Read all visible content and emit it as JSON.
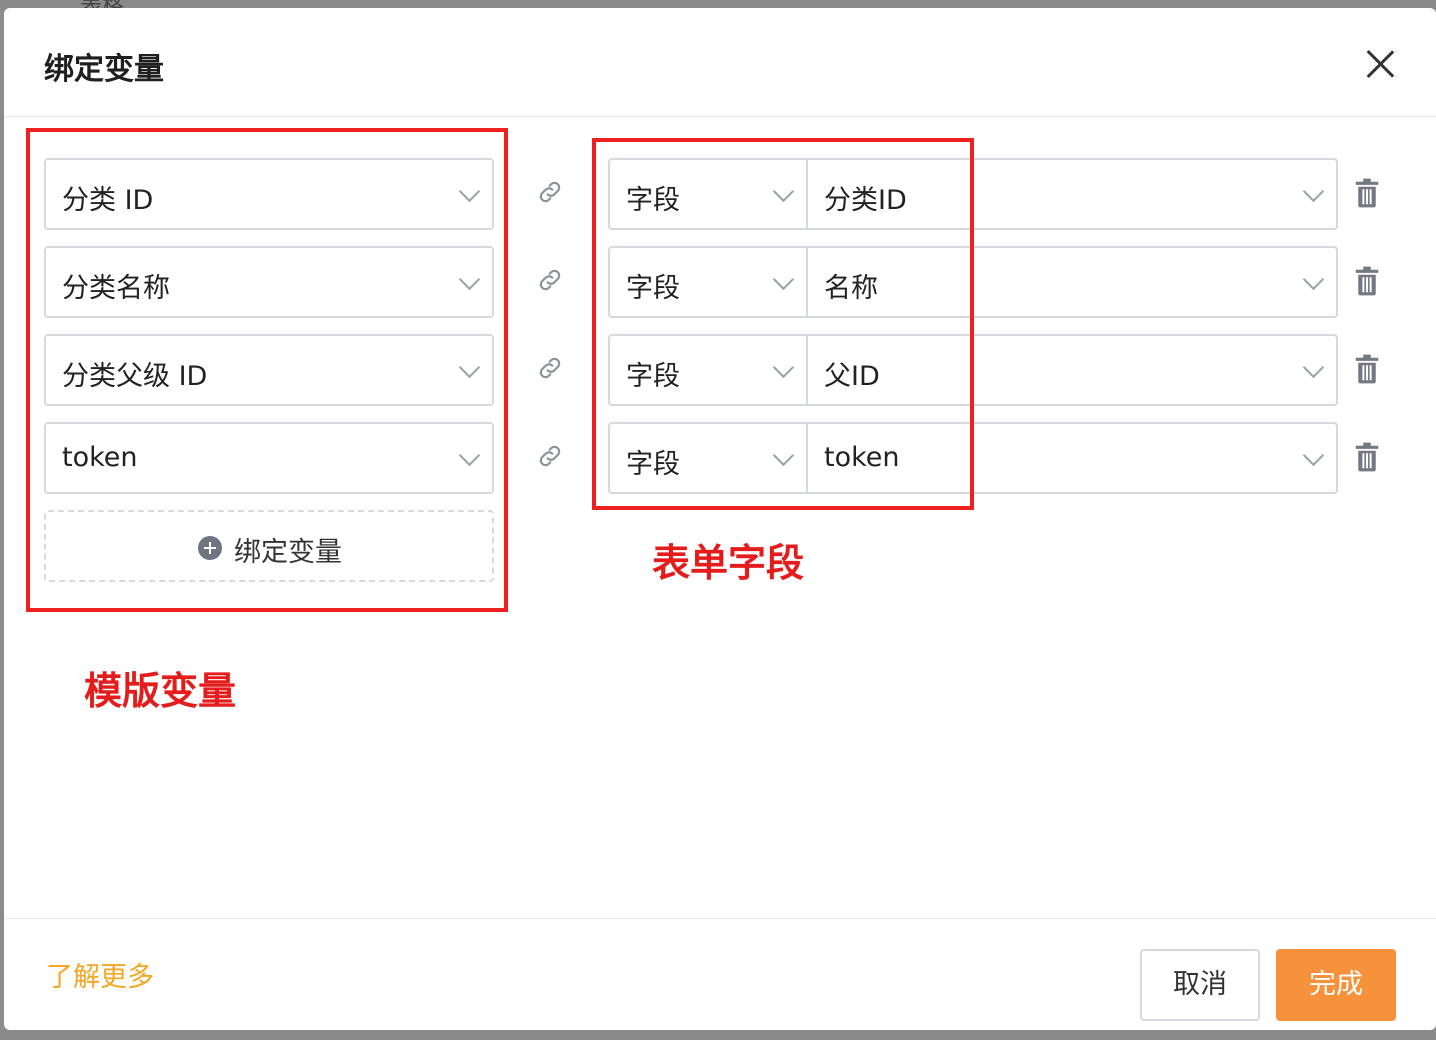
{
  "backdrop": {
    "text": "表格"
  },
  "dialog": {
    "title": "绑定变量"
  },
  "bindings": [
    {
      "variable": "分类 ID",
      "type": "字段",
      "field": "分类ID"
    },
    {
      "variable": "分类名称",
      "type": "字段",
      "field": "名称"
    },
    {
      "variable": "分类父级 ID",
      "type": "字段",
      "field": "父ID"
    },
    {
      "variable": "token",
      "type": "字段",
      "field": "token"
    }
  ],
  "add_binding_label": "绑定变量",
  "annotations": {
    "template_variables": "模版变量",
    "form_fields": "表单字段"
  },
  "footer": {
    "learn_more": "了解更多",
    "cancel": "取消",
    "done": "完成"
  },
  "colors": {
    "accent": "#f7923c",
    "link": "#f5a623",
    "annotation_red": "#e51c1c"
  },
  "icons": {
    "close": "close-icon",
    "link": "link-icon",
    "delete": "trash-icon",
    "add": "plus-circle-icon",
    "dropdown": "chevron-down-icon"
  }
}
